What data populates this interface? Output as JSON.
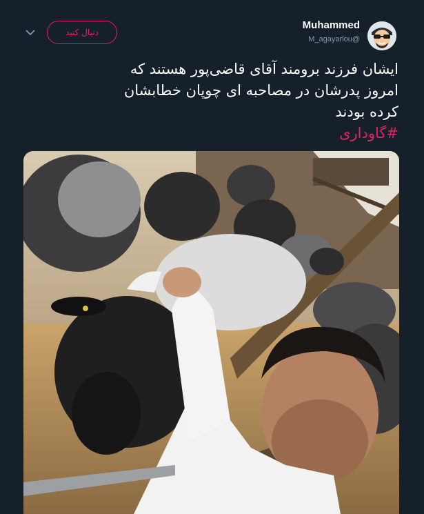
{
  "header": {
    "follow_label": "دنبال کنید",
    "display_name": "Muhammed",
    "handle": "M_agayarlou@"
  },
  "tweet": {
    "lines": [
      "ایشان فرزند برومند آقای قاضی‌پور هستند که",
      "امروز پدرشان در مصاحبه ای چوپان خطابشان",
      "کرده بودند"
    ],
    "hashtag": "#گاوداری"
  },
  "icons": {
    "chevron": "chevron-down-icon",
    "avatar": "cartoon-avatar"
  },
  "colors": {
    "background": "#15202b",
    "accent": "#e0245e",
    "secondary_text": "#8899a6"
  }
}
